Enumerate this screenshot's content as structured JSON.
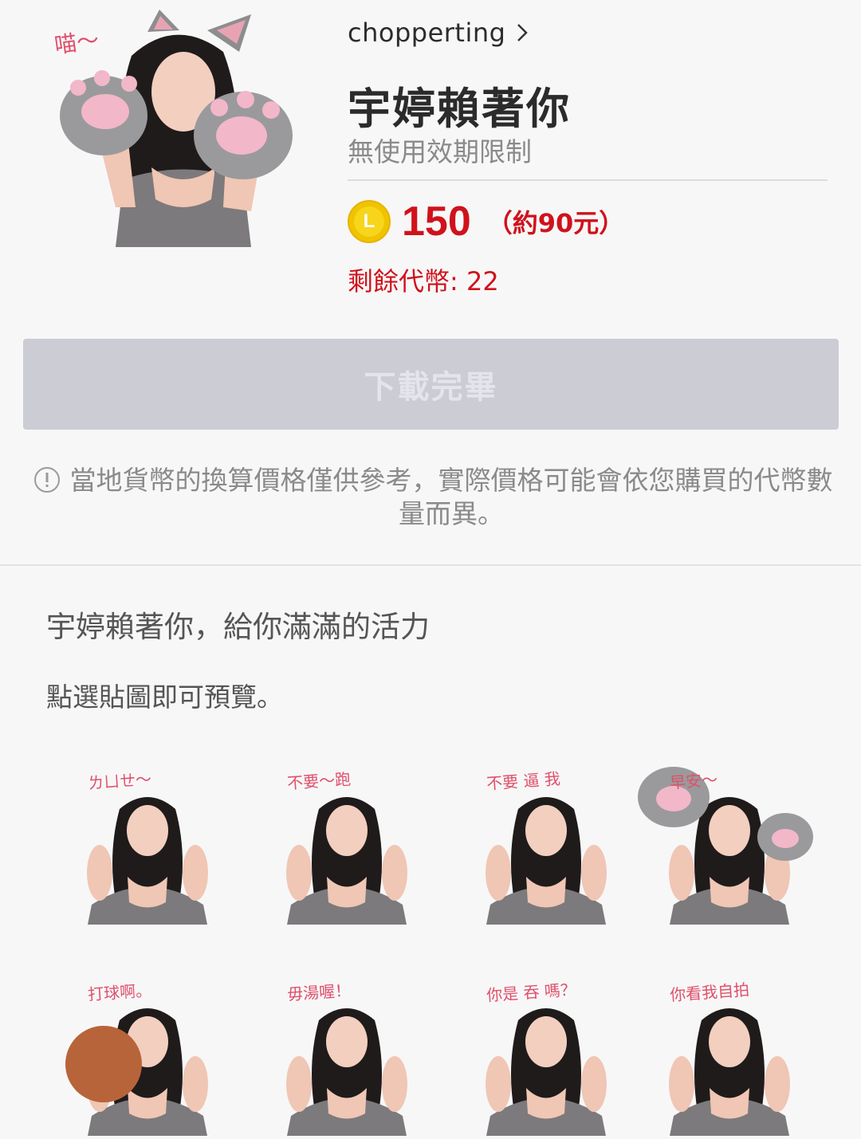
{
  "header": {
    "author": "chopperting",
    "title": "宇婷賴著你",
    "validity": "無使用效期限制",
    "coin_letter": "L",
    "price": "150",
    "price_approx": "（約90元）",
    "balance": "剩餘代幣: 22"
  },
  "hero_sticker": {
    "caption": "喵～"
  },
  "actions": {
    "download_label": "下載完畢"
  },
  "notice": {
    "text": "當地貨幣的換算價格僅供參考，實際價格可能會依您購買的代幣數量而異。"
  },
  "description": "宇婷賴著你，給你滿滿的活力",
  "preview_hint": "點選貼圖即可預覽。",
  "stickers": [
    {
      "caption": "ㄌㄩㄝ～"
    },
    {
      "caption": "不要～跑"
    },
    {
      "caption": "不要 逼 我"
    },
    {
      "caption": "早安～"
    },
    {
      "caption": "打球啊。"
    },
    {
      "caption": "毋湯喔！"
    },
    {
      "caption": "你是 吞 嗎？"
    },
    {
      "caption": "你看我自拍"
    }
  ],
  "colors": {
    "accent": "#d0121b",
    "coin": "#f0c300",
    "button_disabled": "#cbccd4"
  }
}
